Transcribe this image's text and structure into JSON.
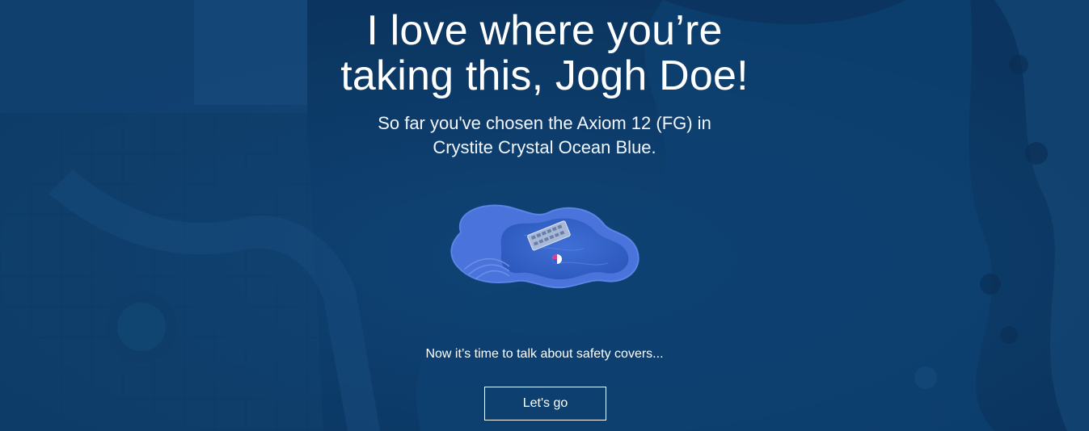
{
  "hero": {
    "headline_line1": "I love where you’re",
    "headline_line2": "taking this, Jogh Doe!",
    "subline_line1": "So far you've chosen the Axiom 12 (FG) in",
    "subline_line2": "Crystite Crystal Ocean Blue."
  },
  "next_step": {
    "prompt": "Now it’s time to talk about safety covers...",
    "button_label": "Let's go"
  },
  "illustration": {
    "icon": "pool-shape-icon",
    "accessories": [
      "pool-float-icon",
      "beach-ball-icon"
    ]
  },
  "colors": {
    "background": "#0d3a64",
    "pool_fill": "#2f5fc4",
    "pool_edge": "#4f7ae0",
    "text": "#ffffff"
  }
}
